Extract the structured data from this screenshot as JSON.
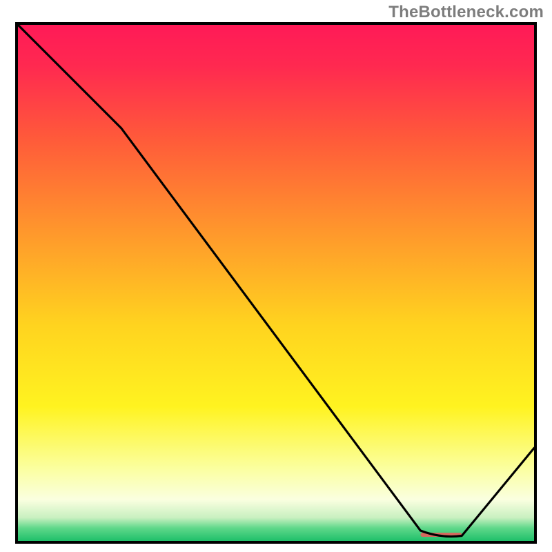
{
  "watermark": "TheBottleneck.com",
  "chart_data": {
    "type": "line",
    "title": "",
    "xlabel": "",
    "ylabel": "",
    "xlim": [
      0,
      100
    ],
    "ylim": [
      0,
      100
    ],
    "series": [
      {
        "name": "curve",
        "x": [
          0,
          20,
          78,
          82,
          86,
          100
        ],
        "y": [
          100,
          80,
          2,
          1,
          1,
          18
        ]
      }
    ],
    "marker_band": {
      "x_start": 78,
      "x_end": 86,
      "y": 1.2,
      "color": "#d46a5e"
    },
    "background_gradient": {
      "stops": [
        {
          "offset": 0.0,
          "color": "#ff1a57"
        },
        {
          "offset": 0.08,
          "color": "#ff2950"
        },
        {
          "offset": 0.22,
          "color": "#ff5a3a"
        },
        {
          "offset": 0.4,
          "color": "#ff972c"
        },
        {
          "offset": 0.58,
          "color": "#ffd31f"
        },
        {
          "offset": 0.74,
          "color": "#fff320"
        },
        {
          "offset": 0.86,
          "color": "#fbffa0"
        },
        {
          "offset": 0.92,
          "color": "#faffe0"
        },
        {
          "offset": 0.955,
          "color": "#c8f0c0"
        },
        {
          "offset": 0.975,
          "color": "#5fd88a"
        },
        {
          "offset": 1.0,
          "color": "#1fbf6a"
        }
      ]
    }
  }
}
